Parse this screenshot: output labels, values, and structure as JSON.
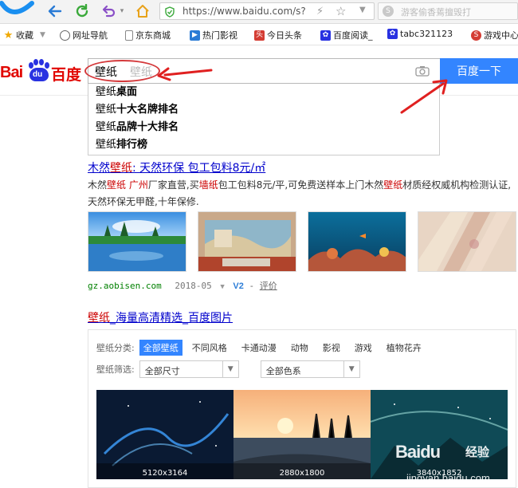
{
  "browser": {
    "url": "https://www.baidu.com/s?",
    "search_placeholder": "游客偷香蔫擅毁打"
  },
  "bookmarks": [
    {
      "label": "收藏",
      "icon": "star-icon"
    },
    {
      "label": "网址导航",
      "icon": "globe-icon"
    },
    {
      "label": "京东商城",
      "icon": "page-icon"
    },
    {
      "label": "热门影视",
      "icon": "play-icon"
    },
    {
      "label": "今日头条",
      "icon": "toutiao-icon"
    },
    {
      "label": "百度阅读_",
      "icon": "paw-icon"
    },
    {
      "label": "tabc321123",
      "icon": "paw-icon"
    },
    {
      "label": "游戏中心",
      "icon": "game-icon"
    }
  ],
  "baidu": {
    "logo_bai": "Bai",
    "logo_du": "du",
    "logo_cn": "百度",
    "query": "壁纸",
    "ghost": "壁纸",
    "search_button": "百度一下"
  },
  "suggestions": [
    {
      "pre": "壁纸",
      "bold": "桌面"
    },
    {
      "pre": "壁纸",
      "bold": "十大名牌排名"
    },
    {
      "pre": "壁纸",
      "bold": "品牌十大排名"
    },
    {
      "pre": "壁纸",
      "bold": "排行榜"
    }
  ],
  "result1": {
    "title_a": "木然",
    "title_hl": "壁纸",
    "title_b": ": 天然环保 包工包料8元/㎡",
    "desc": [
      {
        "t": "木然",
        "h": false
      },
      {
        "t": "壁纸",
        "h": true
      },
      {
        "t": " ",
        "h": false
      },
      {
        "t": "广州",
        "h": true
      },
      {
        "t": "厂家直营,买",
        "h": false
      },
      {
        "t": "墙纸",
        "h": true
      },
      {
        "t": "包工包料8元/平,可免费送样本上门木然",
        "h": false
      },
      {
        "t": "壁纸",
        "h": true
      },
      {
        "t": "材质经权威机构检测认证,天然环保无甲醛,十年保修.",
        "h": false
      }
    ],
    "url": "gz.aobisen.com",
    "date": "2018-05",
    "vbadge": "V2",
    "eval": "评价"
  },
  "result2": {
    "title_hl": "壁纸",
    "title_b": "_海量高清精选_百度图片"
  },
  "image_block": {
    "cat_label": "壁纸分类:",
    "categories": [
      "全部壁纸",
      "不同风格",
      "卡通动漫",
      "动物",
      "影视",
      "游戏",
      "植物花卉"
    ],
    "filter_label": "壁纸筛选:",
    "size_option": "全部尺寸",
    "color_option": "全部色系",
    "images": [
      {
        "res": "5120x3164"
      },
      {
        "res": "2880x1800"
      },
      {
        "res": "3840x1852"
      }
    ]
  },
  "watermark": {
    "t1": "Baidu",
    "t2": "jingyan.baidu.com",
    "exp": "经验"
  }
}
